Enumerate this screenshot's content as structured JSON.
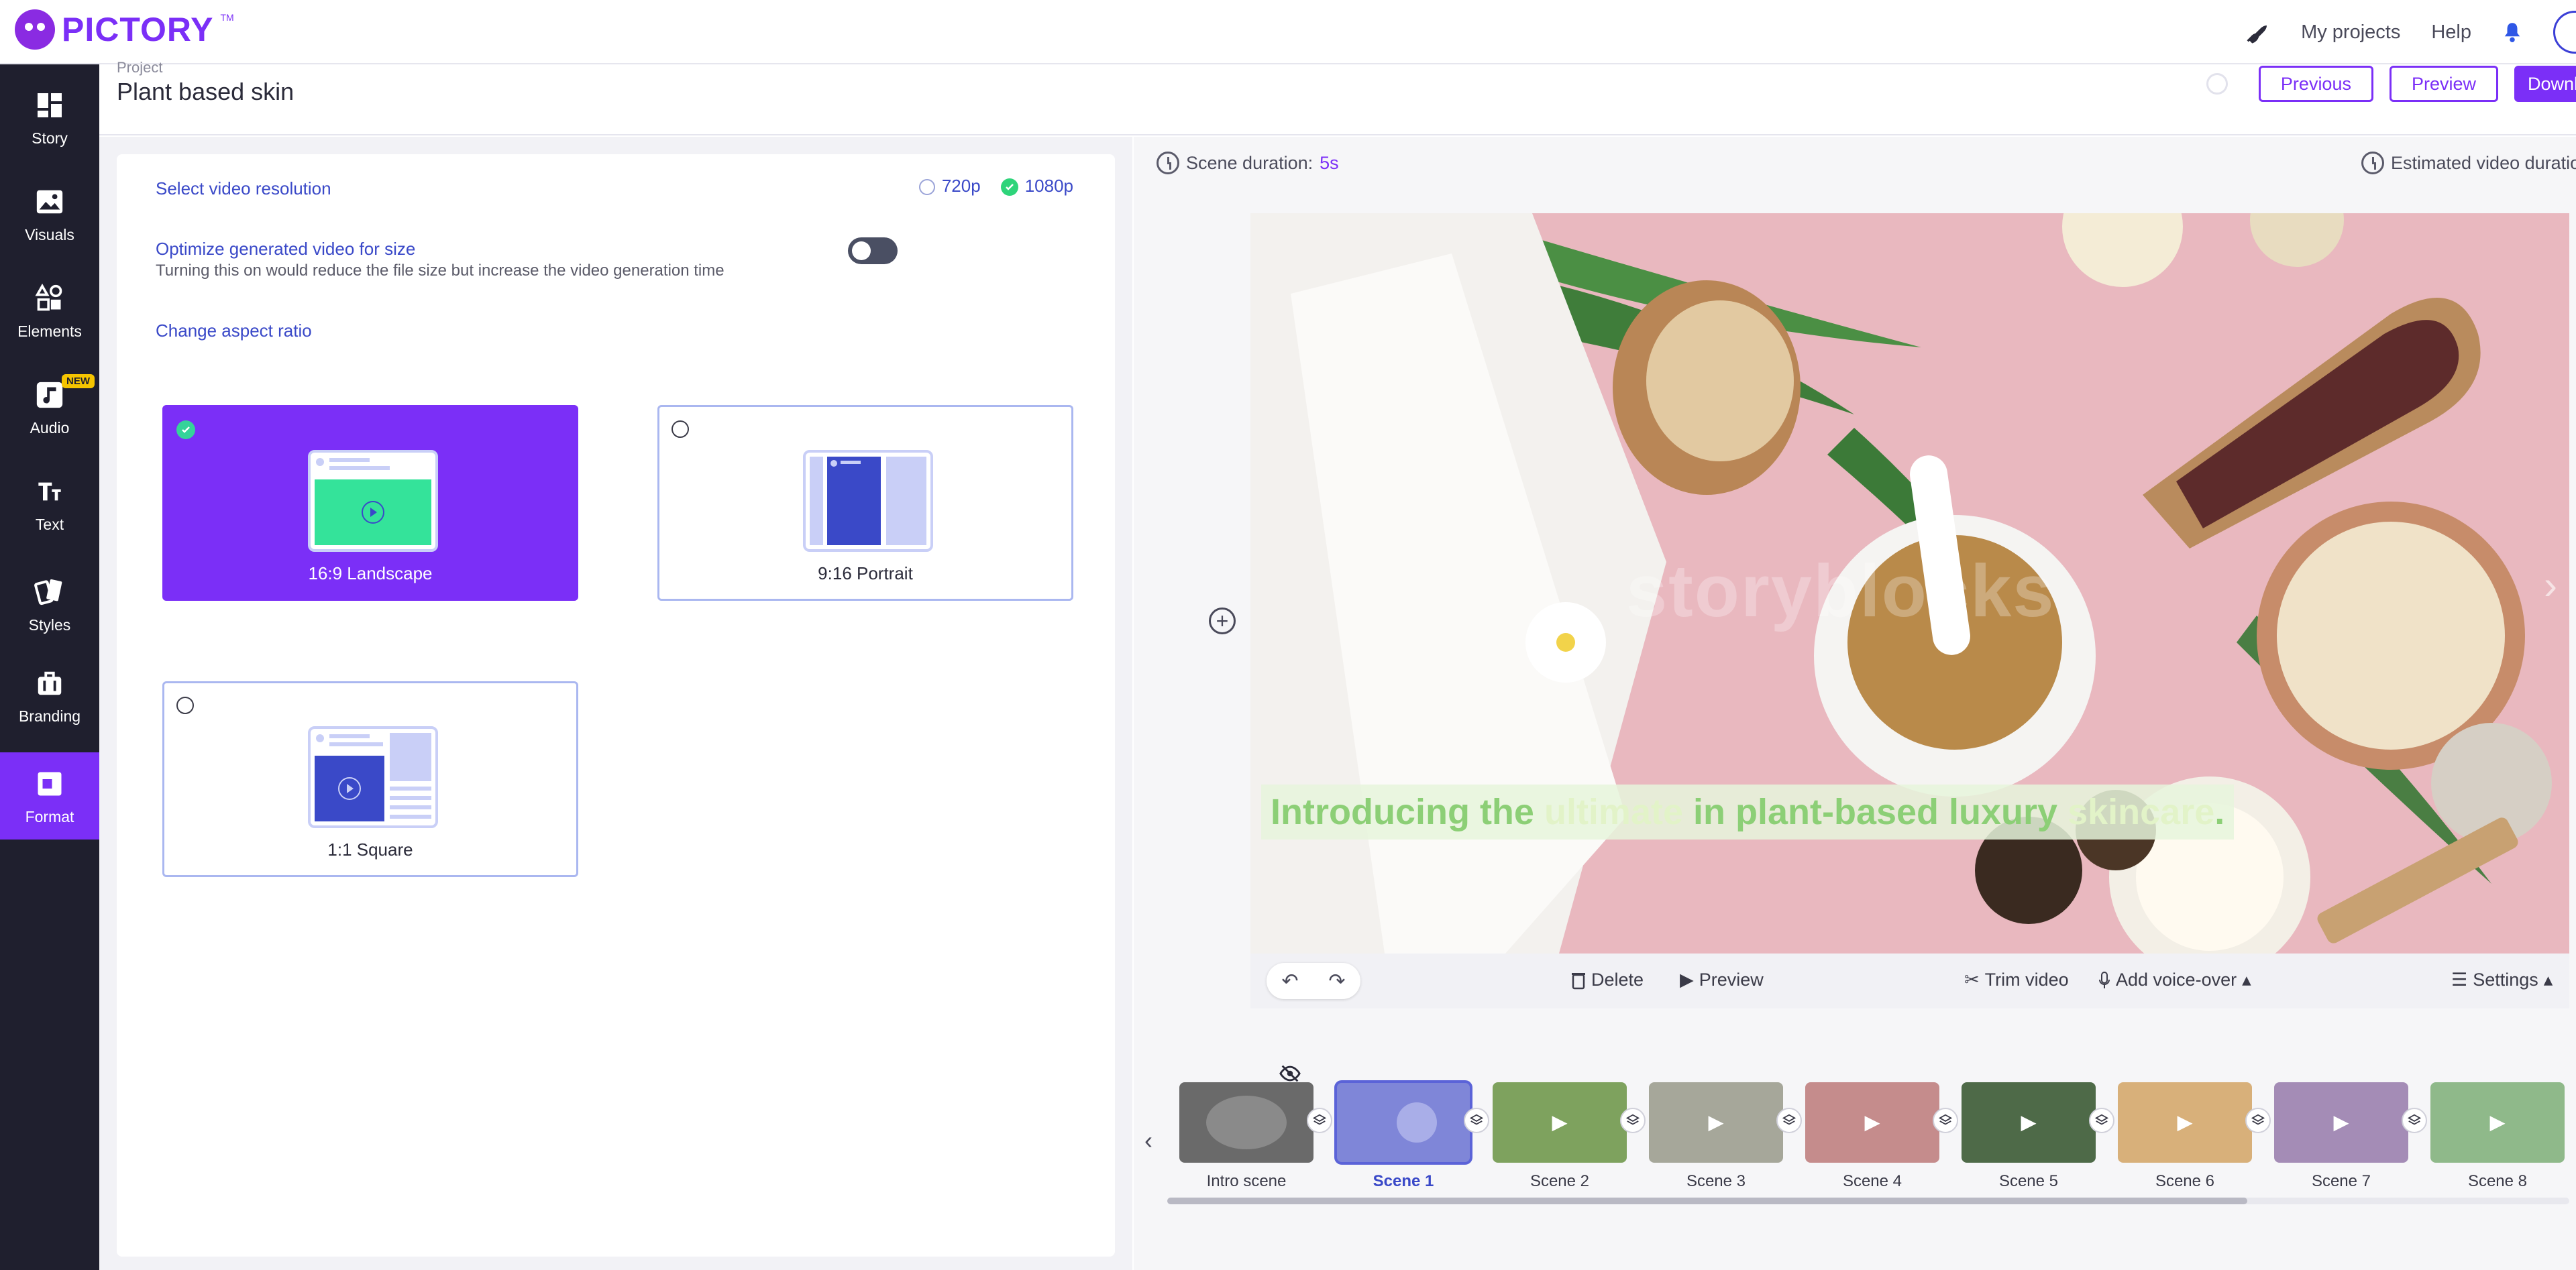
{
  "brand": {
    "name": "PICTORY",
    "tm": "TM"
  },
  "topnav": {
    "projects": "My projects",
    "help": "Help"
  },
  "sidebar": {
    "items": [
      {
        "label": "Story",
        "icon": "story-icon"
      },
      {
        "label": "Visuals",
        "icon": "image-icon"
      },
      {
        "label": "Elements",
        "icon": "shapes-icon"
      },
      {
        "label": "Audio",
        "icon": "music-icon",
        "badge": "NEW"
      },
      {
        "label": "Text",
        "icon": "text-icon"
      },
      {
        "label": "Styles",
        "icon": "styles-icon"
      },
      {
        "label": "Branding",
        "icon": "briefcase-icon"
      },
      {
        "label": "Format",
        "icon": "format-icon",
        "active": true
      }
    ]
  },
  "project": {
    "label": "Project",
    "title": "Plant based skin",
    "buttons": {
      "previous": "Previous",
      "preview": "Preview",
      "download": "Download"
    }
  },
  "format": {
    "resolution_label": "Select video resolution",
    "resolution_options": [
      {
        "label": "720p",
        "selected": false
      },
      {
        "label": "1080p",
        "selected": true
      }
    ],
    "optimize_title": "Optimize generated video for size",
    "optimize_desc": "Turning this on would reduce the file size but increase the video generation time",
    "optimize_enabled": false,
    "aspect_label": "Change aspect ratio",
    "aspect_options": [
      {
        "label": "16:9 Landscape",
        "selected": true
      },
      {
        "label": "9:16 Portrait",
        "selected": false
      },
      {
        "label": "1:1 Square",
        "selected": false
      }
    ]
  },
  "editor": {
    "scene_duration_label": "Scene duration:",
    "scene_duration_value": "5s",
    "estimated_label": "Estimated video duration",
    "caption": {
      "parts": [
        {
          "text": "Introducing the ",
          "highlight": false
        },
        {
          "text": "ultimate",
          "highlight": true
        },
        {
          "text": " in plant-based luxury ",
          "highlight": false
        },
        {
          "text": "skincare",
          "highlight": true
        },
        {
          "text": ".",
          "highlight": false
        }
      ]
    },
    "watermark": "storyblocks",
    "toolbar": {
      "delete": "Delete",
      "preview": "Preview",
      "trim": "Trim video",
      "voice": "Add voice-over",
      "settings": "Settings"
    }
  },
  "timeline": {
    "scenes": [
      {
        "label": "Intro scene",
        "color": "#6a6a6a",
        "active": false
      },
      {
        "label": "Scene 1",
        "color": "#7f86d8",
        "active": true
      },
      {
        "label": "Scene 2",
        "color": "#7ea25e",
        "active": false
      },
      {
        "label": "Scene 3",
        "color": "#a6a79a",
        "active": false
      },
      {
        "label": "Scene 4",
        "color": "#c58c8c",
        "active": false
      },
      {
        "label": "Scene 5",
        "color": "#4e6a48",
        "active": false
      },
      {
        "label": "Scene 6",
        "color": "#d8b07a",
        "active": false
      },
      {
        "label": "Scene 7",
        "color": "#a48cb6",
        "active": false
      },
      {
        "label": "Scene 8",
        "color": "#8fb98a",
        "active": false
      }
    ]
  }
}
